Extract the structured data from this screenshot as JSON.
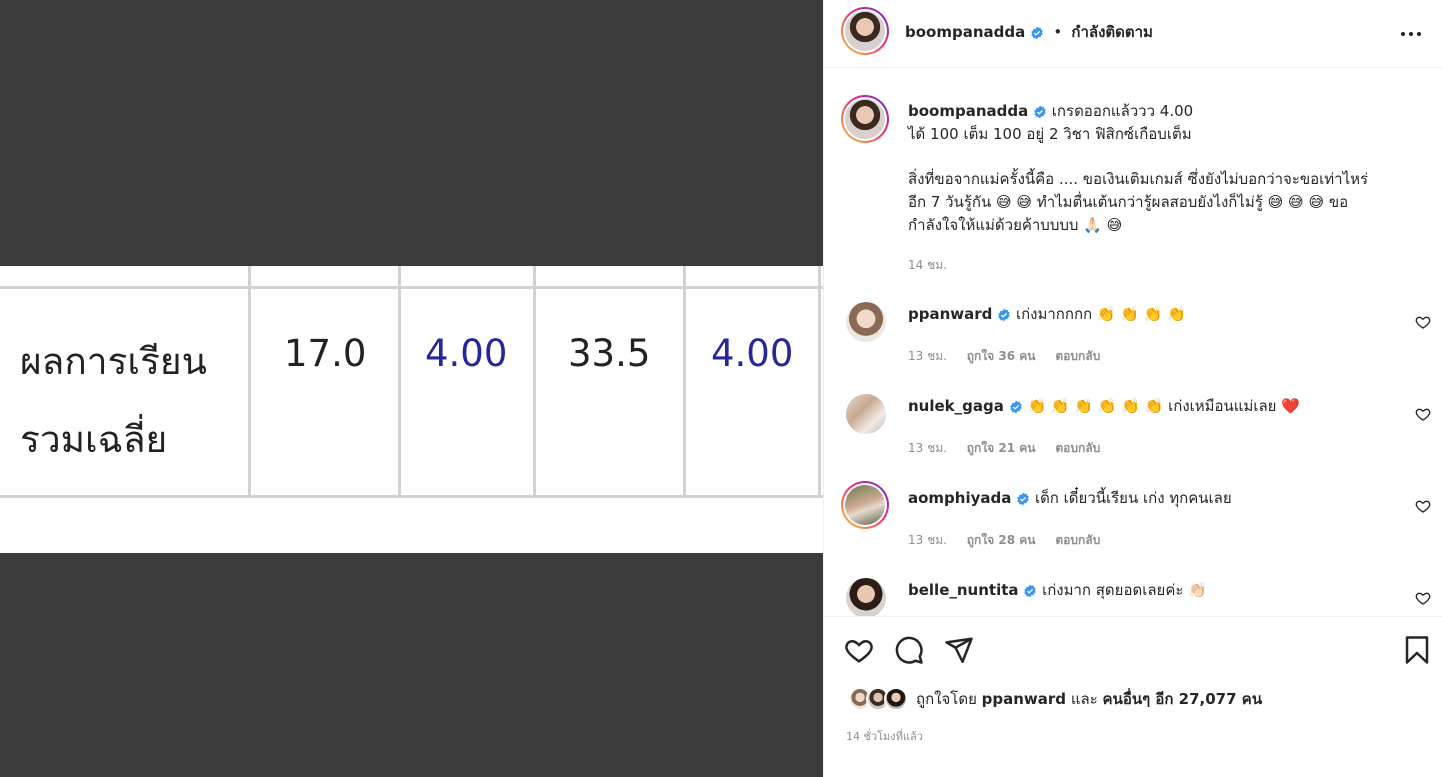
{
  "post": {
    "username": "boompanadda",
    "follow_status": "กำลังติดตาม",
    "more_icon": "more-horizontal-icon"
  },
  "photo": {
    "row_label_line1": "ผลการเรียน",
    "row_label_line2": "รวมเฉลี่ย",
    "cells": [
      "17.0",
      "4.00",
      "33.5",
      "4.00"
    ]
  },
  "caption": {
    "username": "boompanadda",
    "line1": "เกรดออกแล้ววว 4.00",
    "line2": "ได้ 100 เต็ม 100 อยู่ 2 วิชา ฟิสิกซ์เกือบเต็ม",
    "line3": "สิ่งที่ขอจากแม่ครั้งนี้คือ .... ขอเงินเติมเกมส์ ซึ่งยังไม่บอกว่าจะขอเท่าไหร่",
    "line4": "อีก 7 วันรู้กัน 😅 😅  ทำไมตื่นเต้นกว่ารู้ผลสอบยังไงก็ไม่รู้ 😅 😅 😅  ขอ",
    "line5": "กำลังใจให้แม่ด้วยค้าบบบบ 🙏🏻 😅",
    "time": "14 ชม."
  },
  "comments": [
    {
      "username": "ppanward",
      "text": "เก่งมากกกก 👏 👏 👏 👏",
      "time": "13 ชม.",
      "likes": "ถูกใจ 36 คน",
      "reply": "ตอบกลับ"
    },
    {
      "username": "nulek_gaga",
      "text": "👏 👏 👏 👏 👏 👏  เก่งเหมือนแม่เลย ❤️",
      "time": "13 ชม.",
      "likes": "ถูกใจ 21 คน",
      "reply": "ตอบกลับ"
    },
    {
      "username": "aomphiyada",
      "text": "เด็ก เดี๋ยวนี้เรียน เก่ง ทุกคนเลย",
      "time": "13 ชม.",
      "likes": "ถูกใจ 28 คน",
      "reply": "ตอบกลับ"
    },
    {
      "username": "belle_nuntita",
      "text": "เก่งมาก สุดยอดเลยค่ะ 👏🏻",
      "time": "",
      "likes": "",
      "reply": ""
    }
  ],
  "likes": {
    "prefix": "ถูกใจโดย",
    "first_user": "ppanward",
    "and": "และ",
    "others": "คนอื่นๆ อีก 27,077 คน"
  },
  "post_time": "14 ชั่วโมงที่แล้ว",
  "colors": {
    "verified": "#3897f0",
    "heart_red": "#ed4956",
    "grade_blue": "#27279b",
    "media_bg": "#3b3b3b"
  }
}
